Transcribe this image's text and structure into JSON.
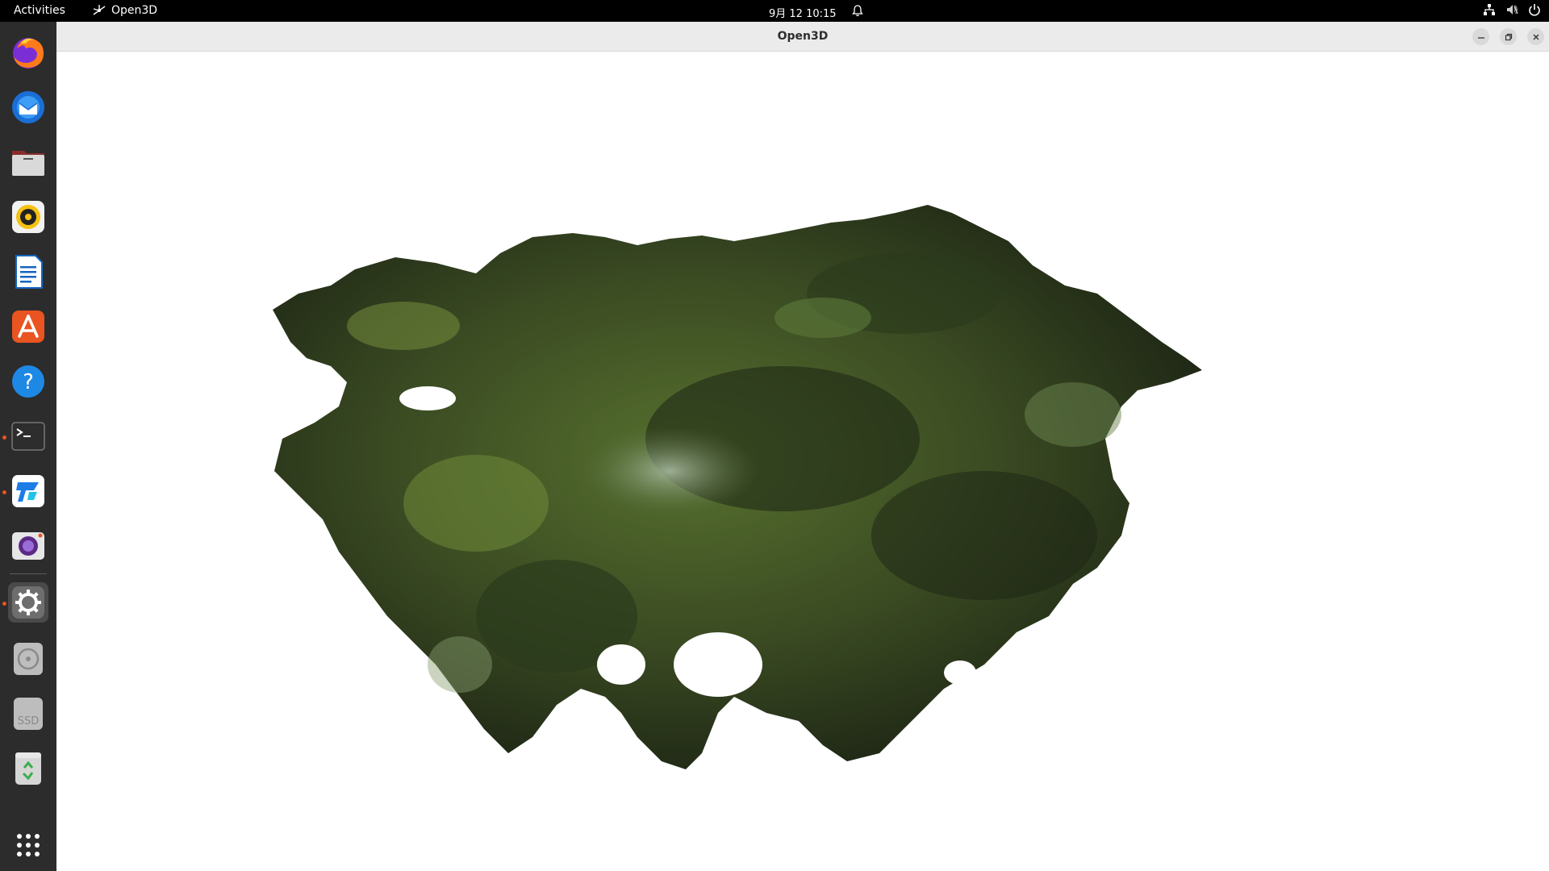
{
  "topbar": {
    "activities_label": "Activities",
    "app_name": "Open3D",
    "clock": "9月 12  10:15",
    "tray_icons": [
      "network-icon",
      "volume-icon",
      "power-icon"
    ]
  },
  "dock": {
    "items": [
      {
        "name": "firefox-icon",
        "running": false
      },
      {
        "name": "thunderbird-icon",
        "running": false
      },
      {
        "name": "files-icon",
        "running": false
      },
      {
        "name": "rhythmbox-icon",
        "running": false
      },
      {
        "name": "libreoffice-writer-icon",
        "running": false
      },
      {
        "name": "app-center-icon",
        "running": false
      },
      {
        "name": "help-icon",
        "running": false
      },
      {
        "name": "terminal-icon",
        "running": true
      },
      {
        "name": "toolbox-icon",
        "running": true
      },
      {
        "name": "screenshot-icon",
        "running": false
      },
      {
        "name": "settings-icon",
        "running": true,
        "active": true
      },
      {
        "name": "disc-icon",
        "running": false
      },
      {
        "name": "ssd-drive-icon",
        "running": false,
        "label": "SSD"
      },
      {
        "name": "trash-icon",
        "running": false
      }
    ],
    "show_apps_icon": "grid-icon"
  },
  "window": {
    "title": "Open3D",
    "buttons": [
      "minimize-icon",
      "maximize-icon",
      "close-icon"
    ]
  },
  "viewport": {
    "content": "3D mesh render",
    "background": "#ffffff",
    "mesh_colors": [
      "#3a4a22",
      "#56702e",
      "#2a3a1c",
      "#8aa070",
      "#1c2414"
    ]
  }
}
